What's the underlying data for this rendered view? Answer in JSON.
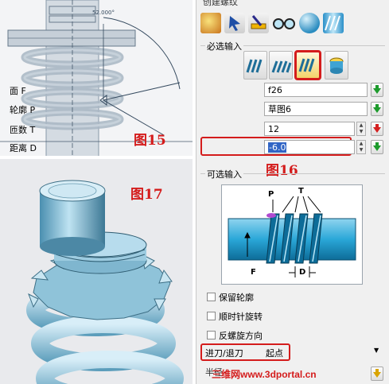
{
  "figure_captions": {
    "fig15": "图15",
    "fig16": "图16",
    "fig17": "图17"
  },
  "cad_view": {
    "dimension_label": "52.000°"
  },
  "panel": {
    "title": "创建螺纹",
    "toolbar_icons": [
      "palette-icon",
      "pointer-tool-icon",
      "ruler-pen-icon",
      "glasses-icon",
      "sphere-icon",
      "thread-icon"
    ],
    "required_group": "必选输入",
    "mode_buttons": [
      "thread-mode-1",
      "thread-mode-2",
      "thread-mode-3",
      "thread-mode-4"
    ],
    "selected_mode": "thread-mode-3",
    "fields": {
      "face": {
        "label": "面 F",
        "value": "f26"
      },
      "profile": {
        "label": "轮廓 P",
        "value": "草图6"
      },
      "turns": {
        "label": "匝数 T",
        "value": "12"
      },
      "distance": {
        "label": "距离 D",
        "value": "-6.0"
      }
    },
    "optional_group": "可选输入",
    "diagram_labels": {
      "p": "P",
      "t": "T",
      "f": "F",
      "d": "D"
    },
    "checkboxes": [
      {
        "label": "保留轮廓",
        "checked": false
      },
      {
        "label": "顺时针旋转",
        "checked": false
      },
      {
        "label": "反螺旋方向",
        "checked": false
      }
    ],
    "feed_label": "进刀/退刀",
    "feed_value": "起点",
    "bottom_label": "半径",
    "watermark": "三维网www.3dportal.cn"
  },
  "colors": {
    "highlight_red": "#d41c1c",
    "field_selection": "#3165c5",
    "diagram_blue": "#2aa7d8"
  }
}
